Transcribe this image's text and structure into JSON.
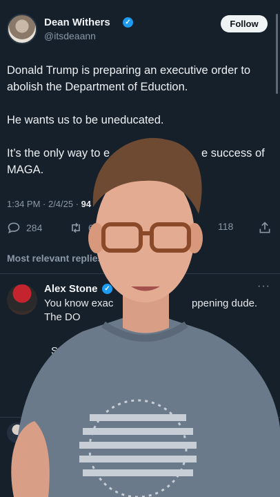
{
  "tweet": {
    "author_name": "Dean Withers",
    "author_handle": "@itsdeaann",
    "follow_label": "Follow",
    "paragraphs": [
      "Donald Trump is preparing an executive order to abolish the Department of Eduction.",
      "He wants us to be uneducated.",
      "It’s the only way to e",
      "e success of",
      "MAGA."
    ],
    "timestamp": "1:34 PM · 2/4/25 · ",
    "views_partial": "94",
    "replies": "284",
    "retweets_partial": "6",
    "bookmarks_partial": "118"
  },
  "replies_section": {
    "label": "Most relevant replies"
  },
  "reply": {
    "author_name": "Alex Stone",
    "more": "···",
    "line1_a": "You know exac",
    "line1_b": "ppening dude.",
    "line2": "The DO",
    "fragment": "S"
  },
  "colors": {
    "background": "#15202b",
    "accent": "#1d9bf0",
    "muted": "#8b98a5"
  },
  "icons": [
    "verified-badge-icon",
    "reply-icon",
    "retweet-icon",
    "share-icon",
    "more-icon"
  ]
}
